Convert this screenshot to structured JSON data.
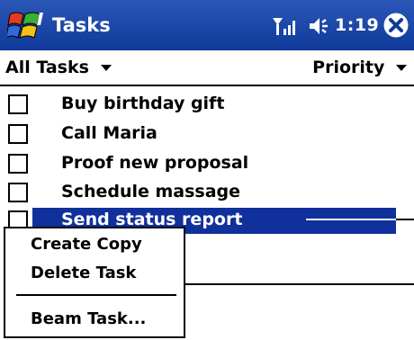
{
  "titlebar": {
    "logo": "windows-flag-icon",
    "title": "Tasks",
    "signal_icon": "signal-antenna-icon",
    "speaker_icon": "speaker-volume-icon",
    "clock": "1:19",
    "close_icon": "close-circle-icon"
  },
  "filterbar": {
    "category": "All Tasks",
    "sort": "Priority"
  },
  "tasks": [
    {
      "label": "Buy birthday gift",
      "checked": false,
      "selected": false
    },
    {
      "label": "Call Maria",
      "checked": false,
      "selected": false
    },
    {
      "label": "Proof new proposal",
      "checked": false,
      "selected": false
    },
    {
      "label": "Schedule massage",
      "checked": false,
      "selected": false
    },
    {
      "label": "Send status report",
      "checked": false,
      "selected": true
    }
  ],
  "context_menu": {
    "items": [
      "Create Copy",
      "Delete Task",
      "Beam Task..."
    ]
  },
  "colors": {
    "titlebar": "#0f3a9a",
    "selection": "#10309c"
  }
}
